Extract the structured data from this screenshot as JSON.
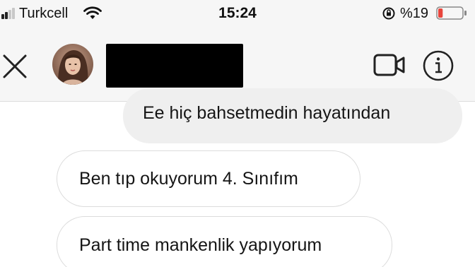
{
  "status_bar": {
    "carrier": "Turkcell",
    "time": "15:24",
    "battery_percent": "%19",
    "battery_level": 0.19,
    "icons": [
      "signal-icon",
      "wifi-icon",
      "rotation-lock-icon",
      "battery-icon"
    ]
  },
  "header": {
    "icons": [
      "close-icon",
      "avatar",
      "video-call-icon",
      "info-icon"
    ]
  },
  "messages": [
    {
      "direction": "outgoing",
      "text": "Ee hiç bahsetmedin hayatından"
    },
    {
      "direction": "incoming",
      "text": "Ben tıp okuyorum 4. Sınıfım"
    },
    {
      "direction": "incoming",
      "text": "Part time mankenlik yapıyorum"
    }
  ],
  "colors": {
    "bar_background": "#f6f6f6",
    "outgoing_bubble": "#efefef",
    "incoming_border": "#dcdcdc",
    "battery_low": "#e8453c"
  }
}
